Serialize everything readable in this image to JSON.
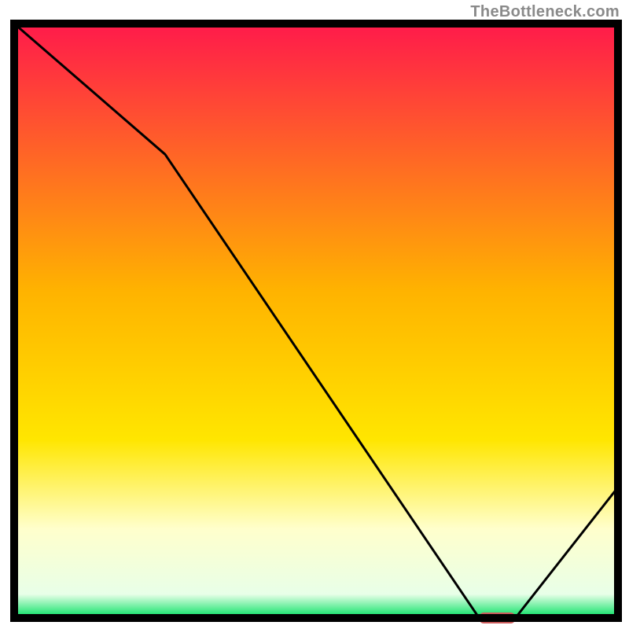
{
  "attribution": "TheBottleneck.com",
  "chart_data": {
    "type": "line",
    "title": "",
    "xlabel": "",
    "ylabel": "",
    "xlim": [
      0,
      100
    ],
    "ylim": [
      0,
      100
    ],
    "x": [
      0,
      25,
      77,
      83,
      100
    ],
    "values": [
      100,
      78,
      0,
      0,
      22
    ],
    "marker": {
      "x_start": 77,
      "x_end": 83,
      "y": 0,
      "color": "#cd5c5c"
    },
    "gradient_stops": [
      {
        "pct": 0,
        "color": "#ff1a4b"
      },
      {
        "pct": 45,
        "color": "#ffb300"
      },
      {
        "pct": 70,
        "color": "#ffe600"
      },
      {
        "pct": 85,
        "color": "#ffffcc"
      },
      {
        "pct": 96,
        "color": "#e8ffe8"
      },
      {
        "pct": 100,
        "color": "#00e060"
      }
    ],
    "frame_color": "#000000",
    "line_color": "#000000",
    "line_width": 3
  }
}
